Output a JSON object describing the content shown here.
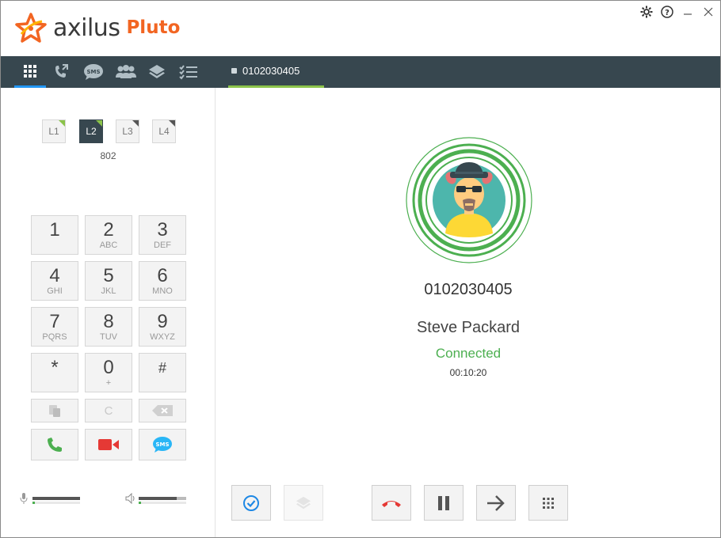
{
  "app": {
    "brand": "axilus",
    "product": "Pluto",
    "brand_color": "#f26522"
  },
  "window_controls": {
    "settings_icon": "gear-icon",
    "help_icon": "help-icon",
    "minimize_icon": "minimize-icon",
    "close_icon": "close-icon"
  },
  "nav": {
    "icons": [
      "dialpad-icon",
      "call-transfer-icon",
      "sms-icon",
      "contacts-icon",
      "layers-icon",
      "checklist-icon"
    ],
    "active_tab": "0102030405",
    "active_color": "#2196f3",
    "tab_accent": "#8bc34a"
  },
  "lines": {
    "items": [
      {
        "label": "L1",
        "active": false
      },
      {
        "label": "L2",
        "active": true
      },
      {
        "label": "L3",
        "active": false
      },
      {
        "label": "L4",
        "active": false
      }
    ],
    "extension": "802"
  },
  "keypad": {
    "keys": [
      {
        "digit": "1",
        "letters": ""
      },
      {
        "digit": "2",
        "letters": "ABC"
      },
      {
        "digit": "3",
        "letters": "DEF"
      },
      {
        "digit": "4",
        "letters": "GHI"
      },
      {
        "digit": "5",
        "letters": "JKL"
      },
      {
        "digit": "6",
        "letters": "MNO"
      },
      {
        "digit": "7",
        "letters": "PQRS"
      },
      {
        "digit": "8",
        "letters": "TUV"
      },
      {
        "digit": "9",
        "letters": "WXYZ"
      },
      {
        "digit": "*",
        "letters": ""
      },
      {
        "digit": "0",
        "letters": "+"
      },
      {
        "digit": "#",
        "letters": ""
      }
    ],
    "paste_icon": "paste-icon",
    "clear_label": "C",
    "backspace_icon": "backspace-icon",
    "call_icon": "phone-icon",
    "video_icon": "video-camera-icon",
    "sms_icon": "sms-icon"
  },
  "audio": {
    "mic_icon": "microphone-icon",
    "speaker_icon": "speaker-icon"
  },
  "call": {
    "number": "0102030405",
    "name": "Steve Packard",
    "status": "Connected",
    "duration": "00:10:20",
    "status_color": "#4caf50"
  },
  "call_controls": {
    "select_icon": "check-circle-icon",
    "conference_icon": "layers-icon",
    "hangup_icon": "hangup-icon",
    "hold_icon": "pause-icon",
    "transfer_icon": "arrow-right-icon",
    "dtmf_icon": "dialpad-icon",
    "hangup_color": "#e53935"
  }
}
